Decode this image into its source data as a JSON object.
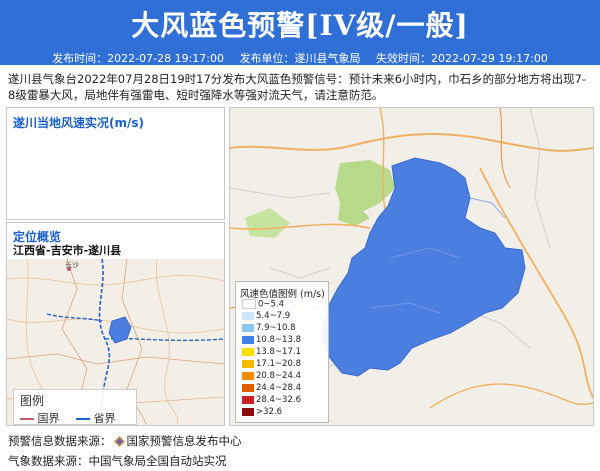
{
  "header": {
    "title": "大风蓝色预警[IV级/一般]",
    "publish_time": "发布时间：2022-07-28 19:17:00",
    "publisher": "发布单位：遂川县气象局",
    "expire_time": "失效时间：2022-07-29 19:17:00"
  },
  "description": "遂川县气象台2022年07月28日19时17分发布大风蓝色预警信号：预计未来6小时内，巾石乡的部分地方将出现7-8级雷暴大风，局地伴有强雷电、短时强降水等强对流天气，请注意防范。",
  "wind_panel": {
    "title": "遂川当地风速实况(m/s)"
  },
  "location_panel": {
    "title": "定位概览",
    "region": "江西省-吉安市-遂川县",
    "legend_title": "图例",
    "legend_items": [
      {
        "label": "国界",
        "color": "#c25a6a"
      },
      {
        "label": "省界",
        "color": "#1f5fd0"
      }
    ],
    "city_label": "长沙"
  },
  "map_legend": {
    "title": "风速色值图例 (m/s)",
    "items": [
      {
        "label": "0~5.4",
        "color": "#ffffff"
      },
      {
        "label": "5.4~7.9",
        "color": "#cfe4f6"
      },
      {
        "label": "7.9~10.8",
        "color": "#8fc4ee"
      },
      {
        "label": "10.8~13.8",
        "color": "#3e82e6"
      },
      {
        "label": "13.8~17.1",
        "color": "#ffe000"
      },
      {
        "label": "17.1~20.8",
        "color": "#f7b800"
      },
      {
        "label": "20.8~24.4",
        "color": "#f08c00"
      },
      {
        "label": "24.4~28.4",
        "color": "#e65a00"
      },
      {
        "label": "28.4~32.6",
        "color": "#c81e1e"
      },
      {
        "label": ">32.6",
        "color": "#8c0a0a"
      }
    ]
  },
  "warning_area_color": "#4a7fe0",
  "footer": {
    "warning_source": "预警信息数据来源：",
    "warning_source_name": "国家预警信息发布中心",
    "weather_source": "气象数据来源：中国气象局全国自动站实况"
  }
}
